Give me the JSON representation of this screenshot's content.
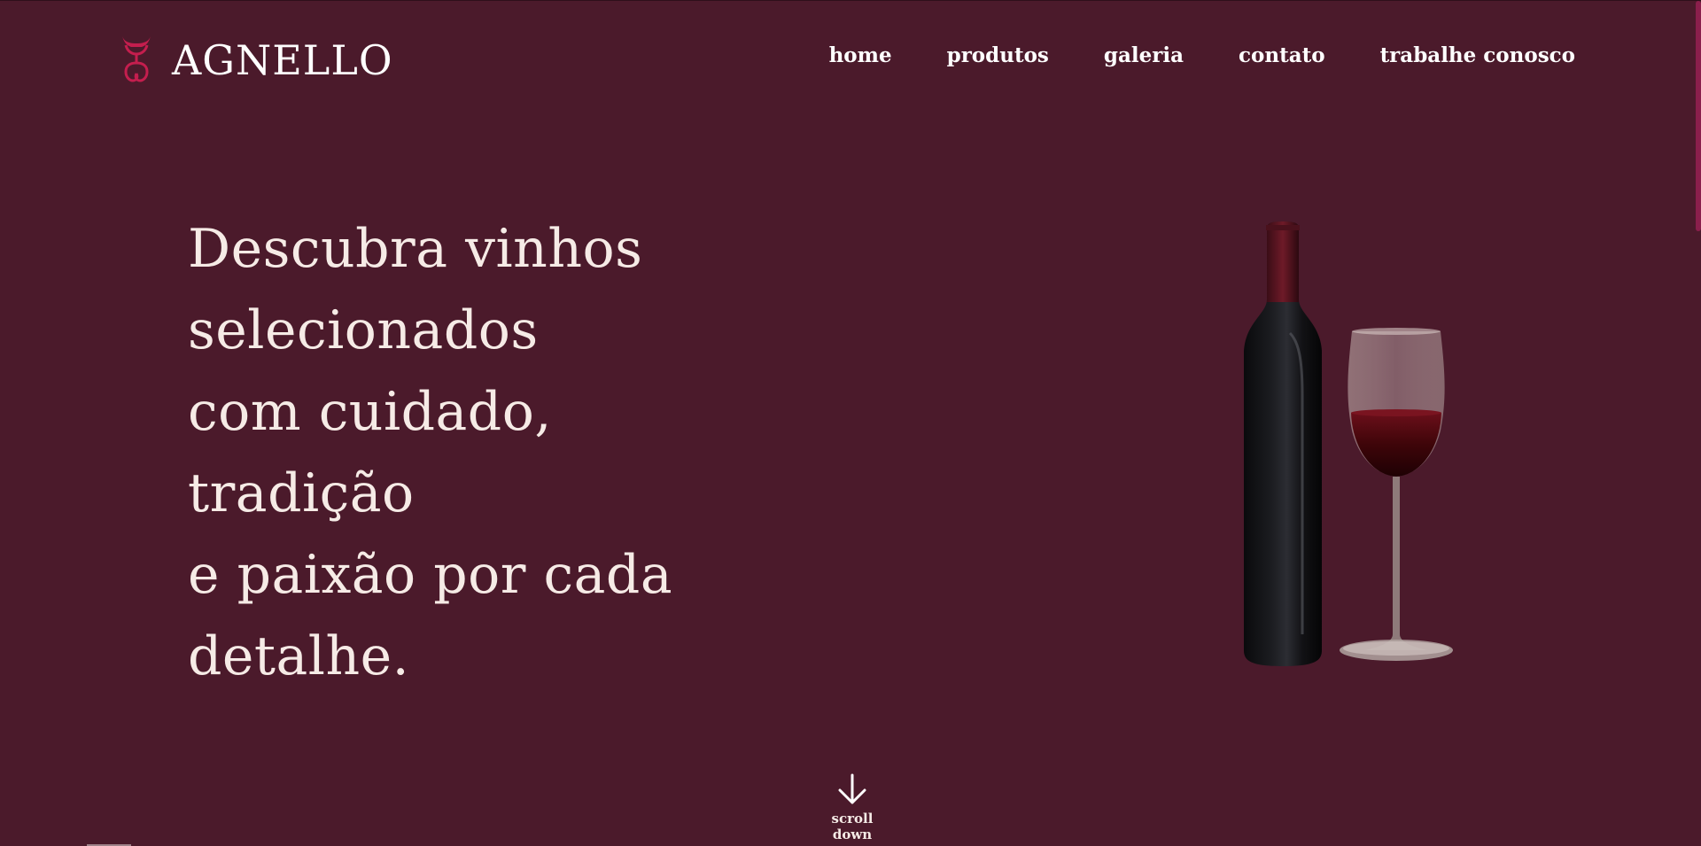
{
  "brand": {
    "name": "AGNELLO",
    "logo_icon": "grape-logo-icon",
    "logo_color": "#c41e4e"
  },
  "nav": {
    "items": [
      {
        "label": "home"
      },
      {
        "label": "produtos"
      },
      {
        "label": "galeria"
      },
      {
        "label": "contato"
      },
      {
        "label": "trabalhe conosco"
      }
    ]
  },
  "hero": {
    "headline_lines": [
      "Descubra vinhos",
      "selecionados",
      "com cuidado,",
      "tradição",
      "e paixão por cada",
      "detalhe."
    ],
    "image": "wine-bottle-and-glass-illustration"
  },
  "scroll": {
    "label": "scroll down",
    "icon": "arrow-down-icon"
  },
  "colors": {
    "background": "#4b1a2b",
    "text": "#f6ebe6",
    "accent": "#c41e4e",
    "scrollbar_thumb": "#8a1f4c"
  }
}
